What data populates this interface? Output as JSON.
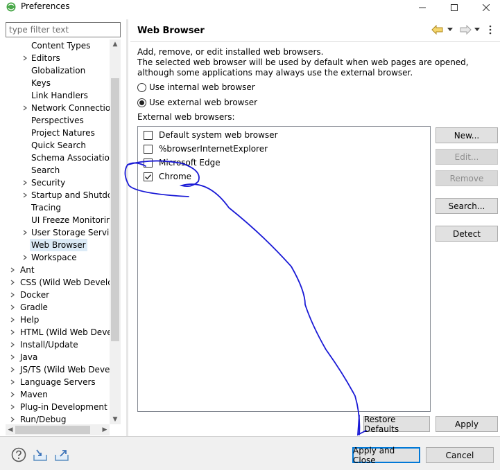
{
  "window": {
    "title": "Preferences",
    "minimize_icon": "minimize-icon",
    "maximize_icon": "maximize-icon",
    "close_icon": "close-icon"
  },
  "filter": {
    "placeholder": "type filter text",
    "value": ""
  },
  "tree": {
    "items": [
      {
        "label": "Content Types",
        "expandable": false,
        "level": 1
      },
      {
        "label": "Editors",
        "expandable": true,
        "level": 1
      },
      {
        "label": "Globalization",
        "expandable": false,
        "level": 1
      },
      {
        "label": "Keys",
        "expandable": false,
        "level": 1
      },
      {
        "label": "Link Handlers",
        "expandable": false,
        "level": 1
      },
      {
        "label": "Network Connections",
        "expandable": true,
        "level": 1
      },
      {
        "label": "Perspectives",
        "expandable": false,
        "level": 1
      },
      {
        "label": "Project Natures",
        "expandable": false,
        "level": 1
      },
      {
        "label": "Quick Search",
        "expandable": false,
        "level": 1
      },
      {
        "label": "Schema Associations",
        "expandable": false,
        "level": 1
      },
      {
        "label": "Search",
        "expandable": false,
        "level": 1
      },
      {
        "label": "Security",
        "expandable": true,
        "level": 1
      },
      {
        "label": "Startup and Shutdown",
        "expandable": true,
        "level": 1
      },
      {
        "label": "Tracing",
        "expandable": false,
        "level": 1
      },
      {
        "label": "UI Freeze Monitoring",
        "expandable": false,
        "level": 1
      },
      {
        "label": "User Storage Service",
        "expandable": true,
        "level": 1
      },
      {
        "label": "Web Browser",
        "expandable": false,
        "level": 1,
        "selected": true
      },
      {
        "label": "Workspace",
        "expandable": true,
        "level": 1
      },
      {
        "label": "Ant",
        "expandable": true,
        "level": 0
      },
      {
        "label": "CSS (Wild Web Developer)",
        "expandable": true,
        "level": 0
      },
      {
        "label": "Docker",
        "expandable": true,
        "level": 0
      },
      {
        "label": "Gradle",
        "expandable": true,
        "level": 0
      },
      {
        "label": "Help",
        "expandable": true,
        "level": 0
      },
      {
        "label": "HTML (Wild Web Developer)",
        "expandable": true,
        "level": 0
      },
      {
        "label": "Install/Update",
        "expandable": true,
        "level": 0
      },
      {
        "label": "Java",
        "expandable": true,
        "level": 0
      },
      {
        "label": "JS/TS (Wild Web Developer)",
        "expandable": true,
        "level": 0
      },
      {
        "label": "Language Servers",
        "expandable": true,
        "level": 0
      },
      {
        "label": "Maven",
        "expandable": true,
        "level": 0
      },
      {
        "label": "Plug-in Development",
        "expandable": true,
        "level": 0
      },
      {
        "label": "Run/Debug",
        "expandable": true,
        "level": 0
      }
    ]
  },
  "page": {
    "title": "Web Browser",
    "back_icon": "arrow-left-icon",
    "forward_icon": "arrow-right-icon",
    "menu_icon": "view-menu-icon",
    "description_line1": "Add, remove, or edit installed web browsers.",
    "description_line2": "The selected web browser will be used by default when web pages are opened, although some applications may always use the external browser.",
    "radio_internal": "Use internal web browser",
    "radio_external": "Use external web browser",
    "selected_mode": "external",
    "external_label": "External web browsers:",
    "browsers": [
      {
        "name": "Default system web browser",
        "checked": false
      },
      {
        "name": "%browserInternetExplorer",
        "checked": false
      },
      {
        "name": "Microsoft Edge",
        "checked": false
      },
      {
        "name": "Chrome",
        "checked": true
      }
    ],
    "buttons": {
      "new": "New...",
      "edit": "Edit...",
      "remove": "Remove",
      "search": "Search...",
      "detect": "Detect",
      "restore_defaults": "Restore Defaults",
      "apply": "Apply"
    }
  },
  "footer": {
    "help_icon": "help-icon",
    "import_icon": "import-icon",
    "export_icon": "export-icon",
    "apply_and_close": "Apply and Close",
    "cancel": "Cancel"
  },
  "colors": {
    "selection": "#dcebf7",
    "default_button_border": "#0078d7",
    "annotation_ink": "#1a1ad6"
  }
}
